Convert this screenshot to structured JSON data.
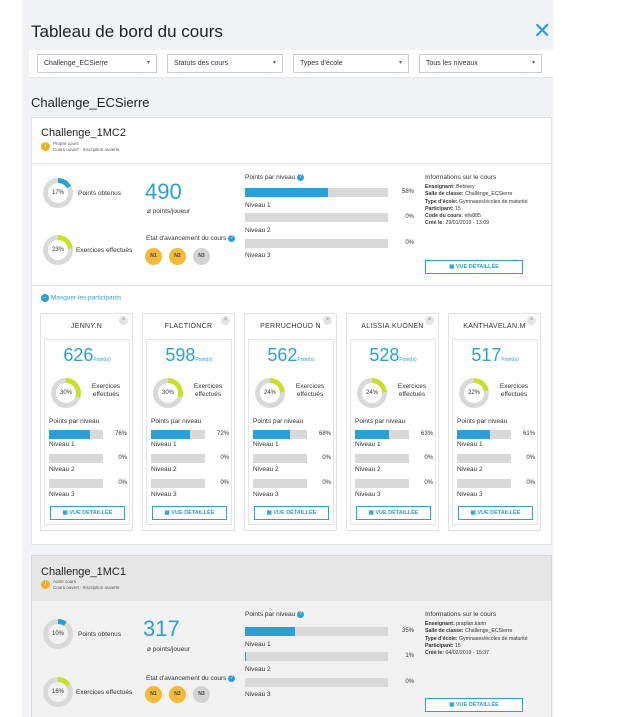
{
  "page": {
    "title": "Tableau de bord du cours",
    "close_icon": "close-icon"
  },
  "filters": [
    {
      "label": "Challenge_ECSierre"
    },
    {
      "label": "Statuts des cours"
    },
    {
      "label": "Types d'école"
    },
    {
      "label": "Tous les niveaux"
    }
  ],
  "section_title": "Challenge_ECSierre",
  "course1": {
    "title": "Challenge_1MC2",
    "badge": "i",
    "sub1": "Propre cours",
    "sub2": "Cours ouvert - Inscription ouverte",
    "points_pct": "17%",
    "points_pct_value": 17,
    "points_label": "Points obtenus",
    "exercises_pct": "23%",
    "exercises_pct_value": 23,
    "exercises_label": "Exercices effectués",
    "points": "490",
    "points_unit": "ø points/joueur",
    "state_label": "Etat d'avancement du cours",
    "levels_title": "Points par niveau",
    "levels": [
      {
        "name": "Niveau 1",
        "pct": "58%",
        "value": 58
      },
      {
        "name": "Niveau 2",
        "pct": "0%",
        "value": 0
      },
      {
        "name": "Niveau 3",
        "pct": "0%",
        "value": 0
      }
    ],
    "circles": [
      "N1",
      "N2",
      "N3"
    ],
    "info_title": "Informations sur le cours",
    "info": [
      {
        "k": "Enseignant:",
        "v": "Bebisey"
      },
      {
        "k": "Salle de classe:",
        "v": "Challenge_ECSierre"
      },
      {
        "k": "Type d'école:",
        "v": "Gymnases/écoles de maturité"
      },
      {
        "k": "Participant:",
        "v": "15"
      },
      {
        "k": "Code du cours:",
        "v": "ellv885"
      },
      {
        "k": "Créé le:",
        "v": "29/01/2019 - 13:09"
      }
    ],
    "detail_btn": "VUE DÉTAILLÉE",
    "toggle": "Masquer les participants"
  },
  "participants": [
    {
      "name": "JENNY.N",
      "points": "626",
      "ex_pct": "30%",
      "ex_value": 30,
      "lvl": [
        "76%",
        "0%",
        "0%"
      ],
      "lvl_values": [
        76,
        0,
        0
      ]
    },
    {
      "name": "FLACTIONCR",
      "points": "598",
      "ex_pct": "30%",
      "ex_value": 30,
      "lvl": [
        "72%",
        "0%",
        "0%"
      ],
      "lvl_values": [
        72,
        0,
        0
      ]
    },
    {
      "name": "PERRUCHOUD N",
      "points": "562",
      "ex_pct": "24%",
      "ex_value": 24,
      "lvl": [
        "68%",
        "0%",
        "0%"
      ],
      "lvl_values": [
        68,
        0,
        0
      ]
    },
    {
      "name": "ALISSIA.KUONEN",
      "points": "528",
      "ex_pct": "24%",
      "ex_value": 24,
      "lvl": [
        "63%",
        "0%",
        "0%"
      ],
      "lvl_values": [
        63,
        0,
        0
      ]
    },
    {
      "name": "KANTHAVELAN.M",
      "points": "517",
      "ex_pct": "22%",
      "ex_value": 22,
      "lvl": [
        "61%",
        "0%",
        "0%"
      ],
      "lvl_values": [
        61,
        0,
        0
      ]
    }
  ],
  "participant_labels": {
    "unit": "Point(s)",
    "exercises": "Exercices effectués",
    "levels_title": "Points par niveau",
    "lv1": "Niveau 1",
    "lv2": "Niveau 2",
    "lv3": "Niveau 3",
    "detail": "VUE DÉTAILLÉE"
  },
  "course2": {
    "title": "Challenge_1MC1",
    "badge": "i",
    "sub1": "Autre cours",
    "sub2": "Cours ouvert - Inscription ouverte",
    "points_pct": "10%",
    "points_pct_value": 10,
    "points_label": "Points obtenus",
    "exercises_pct": "16%",
    "exercises_pct_value": 16,
    "exercises_label": "Exercices effectués",
    "points": "317",
    "points_unit": "ø points/joueur",
    "state_label": "Etat d'avancement du cours",
    "levels_title": "Points par niveau",
    "levels": [
      {
        "name": "Niveau 1",
        "pct": "35%",
        "value": 35
      },
      {
        "name": "Niveau 2",
        "pct": "1%",
        "value": 1
      },
      {
        "name": "Niveau 3",
        "pct": "0%",
        "value": 0
      }
    ],
    "circles": [
      "N1",
      "N2",
      "N3"
    ],
    "info_title": "Informations sur le cours",
    "info": [
      {
        "k": "Enseignant:",
        "v": "praplan.karin"
      },
      {
        "k": "Salle de classe:",
        "v": "Challenge_ECSierre"
      },
      {
        "k": "Type d'école:",
        "v": "Gymnases/écoles de maturité"
      },
      {
        "k": "Participant:",
        "v": "15"
      },
      {
        "k": "Créé le:",
        "v": "04/02/2019 - 15:37"
      }
    ],
    "detail_btn": "VUE DÉTAILLÉE"
  },
  "colors": {
    "accent": "#2aa0d6",
    "warning": "#f5b93a",
    "donut_fill": "#c8e02a"
  }
}
